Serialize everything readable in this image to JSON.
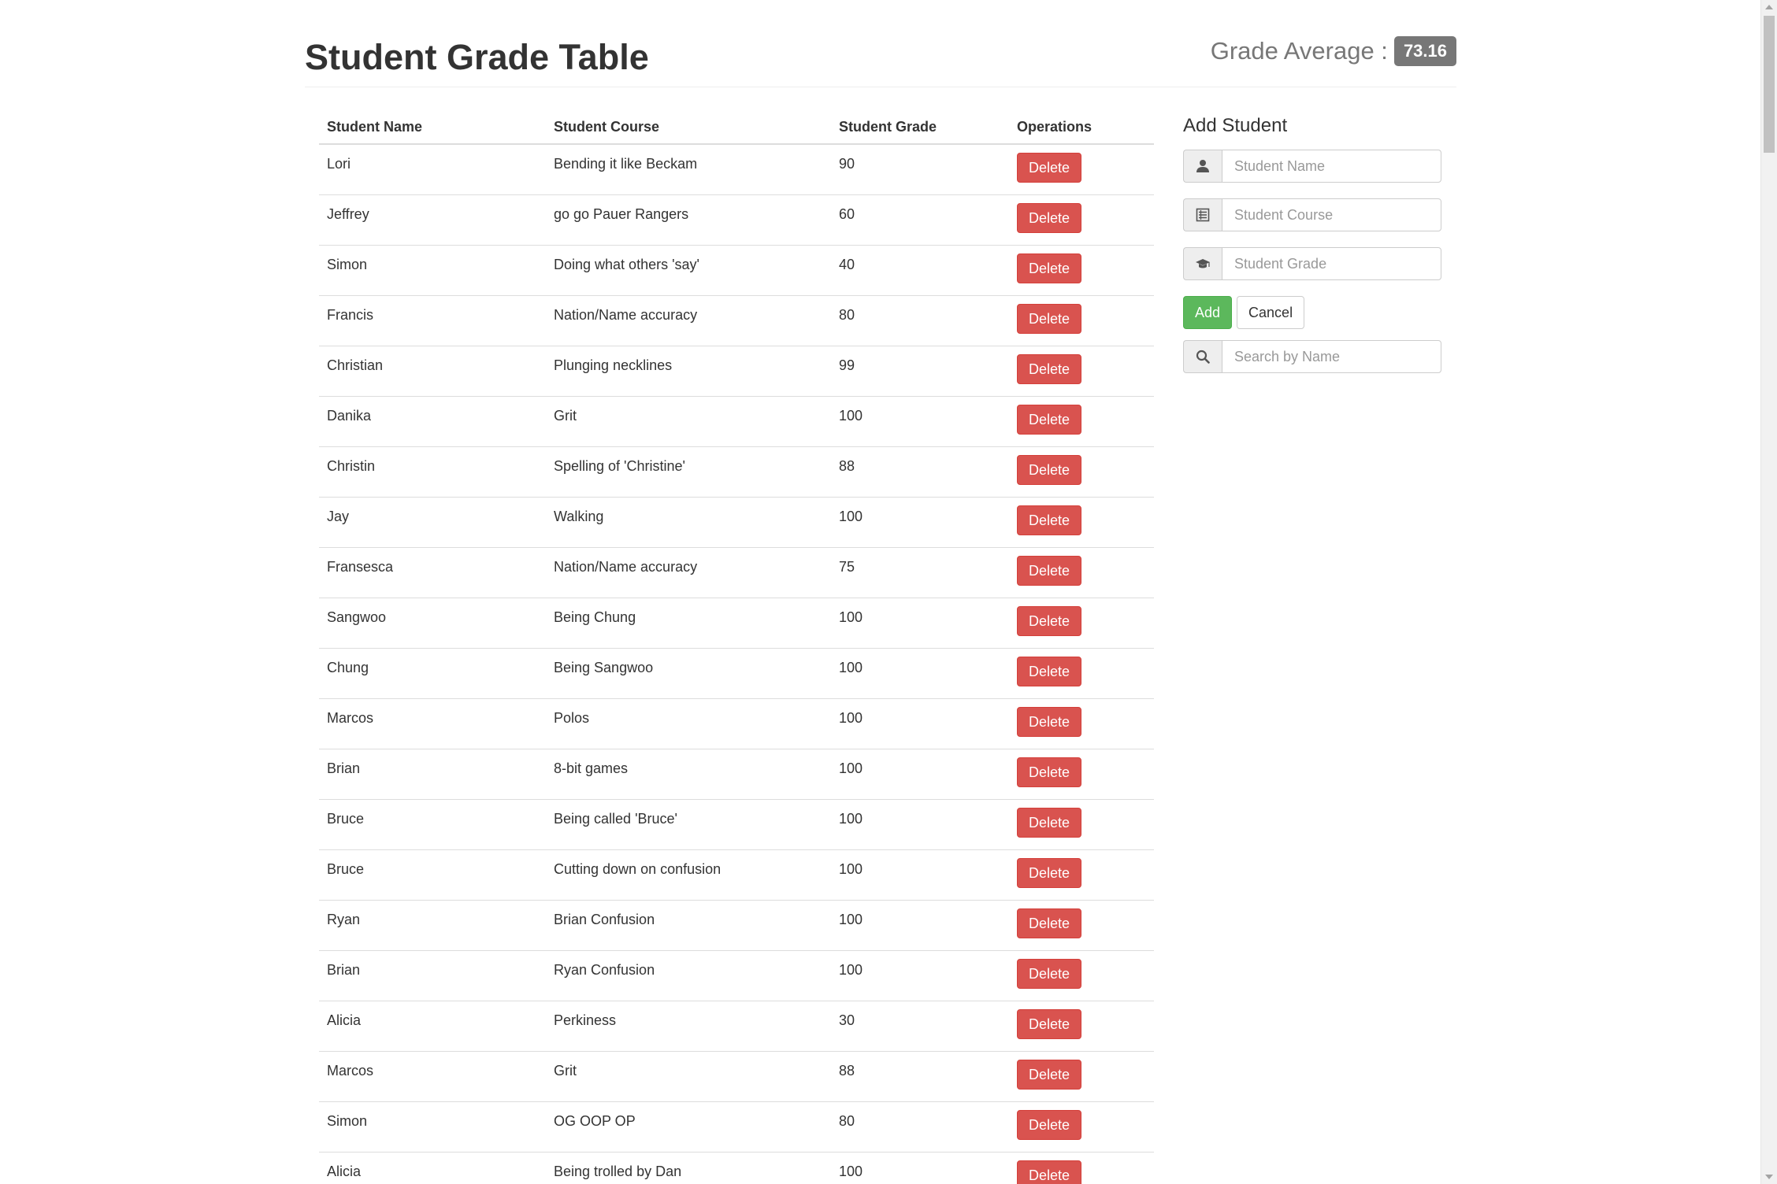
{
  "header": {
    "title": "Student Grade Table",
    "average_label": "Grade Average :",
    "average_value": "73.16"
  },
  "table": {
    "columns": [
      "Student Name",
      "Student Course",
      "Student Grade",
      "Operations"
    ],
    "delete_label": "Delete",
    "rows": [
      {
        "name": "Lori",
        "course": "Bending it like Beckam",
        "grade": "90"
      },
      {
        "name": "Jeffrey",
        "course": "go go Pauer Rangers",
        "grade": "60"
      },
      {
        "name": "Simon",
        "course": "Doing what others 'say'",
        "grade": "40"
      },
      {
        "name": "Francis",
        "course": "Nation/Name accuracy",
        "grade": "80"
      },
      {
        "name": "Christian",
        "course": "Plunging necklines",
        "grade": "99"
      },
      {
        "name": "Danika",
        "course": "Grit",
        "grade": "100"
      },
      {
        "name": "Christin",
        "course": "Spelling of 'Christine'",
        "grade": "88"
      },
      {
        "name": "Jay",
        "course": "Walking",
        "grade": "100"
      },
      {
        "name": "Fransesca",
        "course": "Nation/Name accuracy",
        "grade": "75"
      },
      {
        "name": "Sangwoo",
        "course": "Being Chung",
        "grade": "100"
      },
      {
        "name": "Chung",
        "course": "Being Sangwoo",
        "grade": "100"
      },
      {
        "name": "Marcos",
        "course": "Polos",
        "grade": "100"
      },
      {
        "name": "Brian",
        "course": "8-bit games",
        "grade": "100"
      },
      {
        "name": "Bruce",
        "course": "Being called 'Bruce'",
        "grade": "100"
      },
      {
        "name": "Bruce",
        "course": "Cutting down on confusion",
        "grade": "100"
      },
      {
        "name": "Ryan",
        "course": "Brian Confusion",
        "grade": "100"
      },
      {
        "name": "Brian",
        "course": "Ryan Confusion",
        "grade": "100"
      },
      {
        "name": "Alicia",
        "course": "Perkiness",
        "grade": "30"
      },
      {
        "name": "Marcos",
        "course": "Grit",
        "grade": "88"
      },
      {
        "name": "Simon",
        "course": "OG OOP OP",
        "grade": "80"
      },
      {
        "name": "Alicia",
        "course": "Being trolled by Dan",
        "grade": "100"
      }
    ]
  },
  "form": {
    "title": "Add Student",
    "name_placeholder": "Student Name",
    "course_placeholder": "Student Course",
    "grade_placeholder": "Student Grade",
    "add_label": "Add",
    "cancel_label": "Cancel",
    "search_placeholder": "Search by Name",
    "icons": {
      "name": "user-icon",
      "course": "list-icon",
      "grade": "graduation-cap-icon",
      "search": "search-icon"
    }
  },
  "colors": {
    "danger": "#d9534f",
    "success": "#5cb85c",
    "badge": "#777777"
  }
}
